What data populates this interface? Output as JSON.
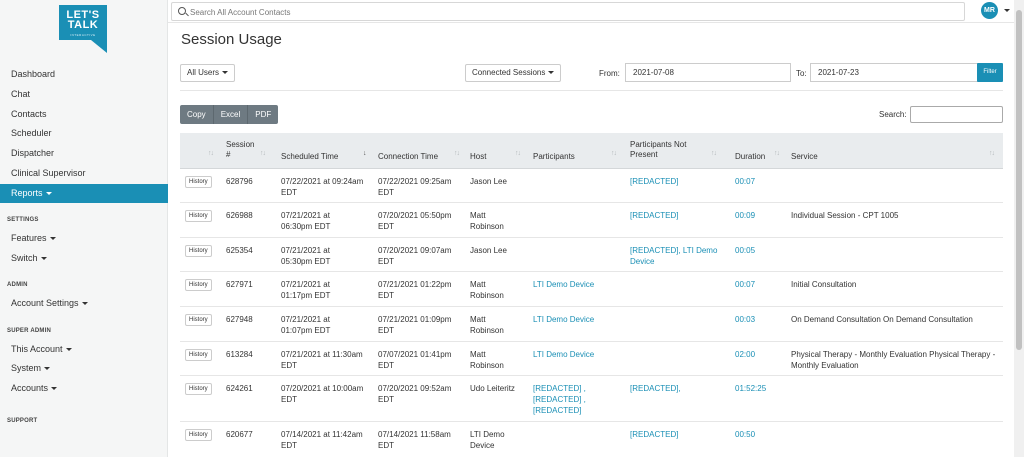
{
  "sidebar": {
    "logo_text": "LET'S TALK",
    "logo_sub": "INTERACTIVE",
    "items": [
      {
        "label": "Dashboard"
      },
      {
        "label": "Chat"
      },
      {
        "label": "Contacts"
      },
      {
        "label": "Scheduler"
      },
      {
        "label": "Dispatcher"
      },
      {
        "label": "Clinical Supervisor"
      },
      {
        "label": "Reports"
      }
    ],
    "sections": {
      "settings": "SETTINGS",
      "admin": "ADMIN",
      "super_admin": "SUPER ADMIN",
      "support": "SUPPORT"
    },
    "settings_items": [
      {
        "label": "Features"
      },
      {
        "label": "Switch"
      }
    ],
    "admin_items": [
      {
        "label": "Account Settings"
      }
    ],
    "super_admin_items": [
      {
        "label": "This Account"
      },
      {
        "label": "System"
      },
      {
        "label": "Accounts"
      }
    ]
  },
  "topbar": {
    "search_placeholder": "Search All Account Contacts",
    "avatar_initials": "MR"
  },
  "page": {
    "title": "Session Usage",
    "users_filter": "All Users",
    "session_type_filter": "Connected Sessions",
    "from_label": "From:",
    "from_value": "2021-07-08",
    "to_label": "To:",
    "to_value": "2021-07-23",
    "filter_button": "Filter",
    "export": {
      "copy": "Copy",
      "excel": "Excel",
      "pdf": "PDF"
    },
    "table_search_label": "Search:"
  },
  "table": {
    "headers": {
      "session": "Session #",
      "scheduled": "Scheduled Time",
      "connection": "Connection Time",
      "host": "Host",
      "participants": "Participants",
      "not_present": "Participants Not Present",
      "duration": "Duration",
      "service": "Service"
    },
    "history_label": "History",
    "rows": [
      {
        "session": "628796",
        "scheduled": "07/22/2021 at 09:24am EDT",
        "connection": "07/22/2021 09:25am EDT",
        "host": "Jason Lee",
        "participants": "",
        "not_present": "[REDACTED]",
        "duration": "00:07",
        "service": ""
      },
      {
        "session": "626988",
        "scheduled": "07/21/2021 at 06:30pm EDT",
        "connection": "07/20/2021 05:50pm EDT",
        "host": "Matt Robinson",
        "participants": "",
        "not_present": "[REDACTED]",
        "duration": "00:09",
        "service": "Individual Session - CPT 1005"
      },
      {
        "session": "625354",
        "scheduled": "07/21/2021 at 05:30pm EDT",
        "connection": "07/20/2021 09:07am EDT",
        "host": "Jason Lee",
        "participants": "",
        "not_present": "[REDACTED], LTI Demo Device",
        "duration": "00:05",
        "service": ""
      },
      {
        "session": "627971",
        "scheduled": "07/21/2021 at 01:17pm EDT",
        "connection": "07/21/2021 01:22pm EDT",
        "host": "Matt Robinson",
        "participants": "LTI Demo Device",
        "not_present": "",
        "duration": "00:07",
        "service": "Initial Consultation"
      },
      {
        "session": "627948",
        "scheduled": "07/21/2021 at 01:07pm EDT",
        "connection": "07/21/2021 01:09pm EDT",
        "host": "Matt Robinson",
        "participants": "LTI Demo Device",
        "not_present": "",
        "duration": "00:03",
        "service": "On Demand Consultation On Demand Consultation"
      },
      {
        "session": "613284",
        "scheduled": "07/21/2021 at 11:30am EDT",
        "connection": "07/07/2021 01:41pm EDT",
        "host": "Matt Robinson",
        "participants": "LTI Demo Device",
        "not_present": "",
        "duration": "02:00",
        "service": "Physical Therapy - Monthly Evaluation Physical Therapy - Monthly Evaluation"
      },
      {
        "session": "624261",
        "scheduled": "07/20/2021 at 10:00am EDT",
        "connection": "07/20/2021 09:52am EDT",
        "host": "Udo Leiteritz",
        "participants": "[REDACTED] , [REDACTED] , [REDACTED]",
        "not_present": "[REDACTED],",
        "duration": "01:52:25",
        "service": ""
      },
      {
        "session": "620677",
        "scheduled": "07/14/2021 at 11:42am EDT",
        "connection": "07/14/2021 11:58am EDT",
        "host": "LTI Demo Device",
        "participants": "",
        "not_present": "[REDACTED]",
        "duration": "00:50",
        "service": ""
      }
    ]
  },
  "colors": {
    "accent": "#1a8fb5",
    "export_button": "#6e7a82",
    "header_bg": "#e9ecee"
  }
}
